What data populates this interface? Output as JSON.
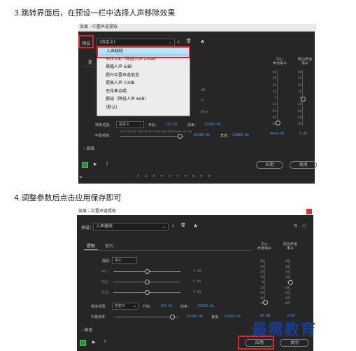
{
  "steps": {
    "step3": "3.跳转界面后，在预设一栏中选择人声移除效果",
    "step4": "4.调整参数后点击应用保存即可"
  },
  "dialog1": {
    "title": "效果 - 中置声道提取",
    "preset_label": "预设",
    "preset_value": "(自定义)",
    "menu_items": [
      "人声移除",
      "卡拉 OK（降低人声 20dB）",
      "增幅人声 6dB",
      "提升中置声道低音",
      "提高人声 10dB",
      "无伴奏合唱",
      "颤调（降低人声 6dB）",
      "(默认)"
    ],
    "tab_partial": "提",
    "meters": {
      "center_label": "中心\n声道电平",
      "side_label": "侧边声道\n电平",
      "center_db": "-44.4 dB",
      "side_db": "0 dB"
    },
    "freq_range_label": "频率范围：",
    "freq_range_value": "自定义",
    "start_label": "开始：",
    "start_value": "120 Hz",
    "end_label": "结束：",
    "end_value": "20000 Hz",
    "center_freq_label": "中置频率：",
    "center_freq_value": "10060 Hz",
    "width_label": "宽度：",
    "width_value": "19880 Hz",
    "advanced_label": "高级",
    "apply_label": "应用",
    "close_label": "关闭",
    "dim_units": [
      "dB",
      "%",
      "0ms"
    ],
    "scale_db": [
      "40",
      "30",
      "20",
      "10",
      "0",
      "-10",
      "-20",
      "-30",
      "-40"
    ],
    "freq_ticks": "20 30 50 100 200 300 500 1000 2000 3000 5000 10k 20k"
  },
  "dialog2": {
    "title": "效果 - 中置声道提取",
    "preset_label": "预设：",
    "preset_value": "人声移除",
    "tab_extract": "提取",
    "tab_discrimination": "鉴别",
    "extract_label": "提取：",
    "extract_value": "中心",
    "row_labels": [
      "中心",
      "侧边",
      "增益"
    ],
    "row_units": [
      "0 dB",
      "0 dB",
      "0 dB"
    ],
    "meters": {
      "center_label": "中心\n声道电平",
      "side_label": "侧边声道\n电平",
      "center_db": "-40 dB",
      "side_db": "0 dB"
    },
    "freq_range_label": "频率范围：",
    "freq_range_value": "自定义",
    "start_label": "开始：",
    "start_value": "120 Hz",
    "end_label": "结束：",
    "end_value": "20000 Hz",
    "center_freq_label": "中置频率：",
    "center_freq_value": "10060 Hz",
    "width_label": "宽度：",
    "width_value": "19880 Hz",
    "advanced_label": "高级",
    "apply_label": "应用",
    "close_label": "关闭",
    "scale_db": [
      "40",
      "30",
      "20",
      "10",
      "0",
      "-10",
      "-20",
      "-30",
      "-40"
    ]
  },
  "watermark": "最需教育",
  "colors": {
    "highlight": "#e0262b",
    "accent": "#4d8fe0",
    "panel_bg": "#262626",
    "power_green": "#2e8b3a"
  }
}
